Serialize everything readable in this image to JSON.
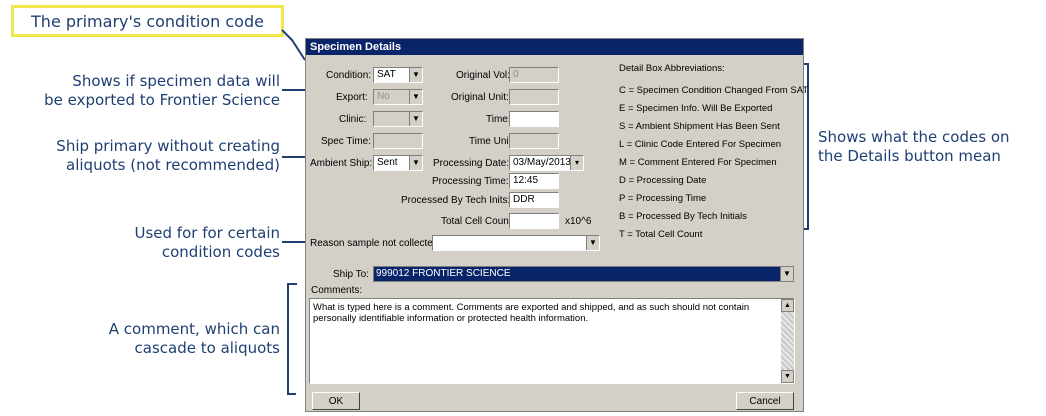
{
  "callouts": {
    "primary_condition": "The primary's condition code",
    "export": [
      "Shows if specimen data will",
      "be exported to Frontier Science"
    ],
    "ship_primary": [
      "Ship primary without creating",
      "aliquots (not recommended)"
    ],
    "used_for": [
      "Used for for certain",
      "condition codes"
    ],
    "comment": [
      "A comment, which can",
      "cascade to aliquots"
    ],
    "codes_meaning": [
      "Shows what the codes on",
      "the Details button mean"
    ]
  },
  "dialog": {
    "title": "Specimen Details",
    "condition_label": "Condition:",
    "condition_value": "SAT",
    "export_label": "Export:",
    "export_value": "No",
    "clinic_label": "Clinic:",
    "clinic_value": "",
    "spec_time_label": "Spec Time:",
    "spec_time_value": "",
    "ambient_ship_label": "Ambient Ship:",
    "ambient_ship_value": "Sent",
    "original_vol_label": "Original Vol:",
    "original_vol_value": "0",
    "original_unit_label": "Original Unit:",
    "original_unit_value": "",
    "time_label": "Time:",
    "time_value": "",
    "time_unit_label": "Time Unit:",
    "time_unit_value": "",
    "processing_date_label": "Processing Date:",
    "processing_date_value": "03/May/2013",
    "processing_time_label": "Processing Time:",
    "processing_time_value": "12:45",
    "processed_by_label": "Processed By Tech Inits:",
    "processed_by_value": "DDR",
    "total_cell_count_label": "Total Cell Count:",
    "total_cell_count_value": "",
    "total_cell_count_unit": "x10^6",
    "reason_label": "Reason sample not collected:",
    "reason_value": "",
    "ship_to_label": "Ship To:",
    "ship_to_value": "999012 FRONTIER SCIENCE",
    "comments_label": "Comments:",
    "comments_text": "What is typed here is a comment. Comments are exported and shipped, and as such should not contain personally identifiable information or protected health information.",
    "ok_label": "OK",
    "cancel_label": "Cancel",
    "abbr_title": "Detail Box Abbreviations:",
    "abbr": [
      "C = Specimen Condition Changed From SAT",
      "E = Specimen Info. Will Be Exported",
      "S = Ambient Shipment Has Been Sent",
      "L = Clinic Code Entered For Specimen",
      "M = Comment Entered For Specimen",
      "D = Processing Date",
      "P = Processing Time",
      "B = Processed By Tech Initials",
      "T = Total Cell Count"
    ]
  },
  "colors": {
    "callout_text": "#1f3f73",
    "highlight_box": "#f0e84a",
    "titlebar": "#0a246a"
  }
}
